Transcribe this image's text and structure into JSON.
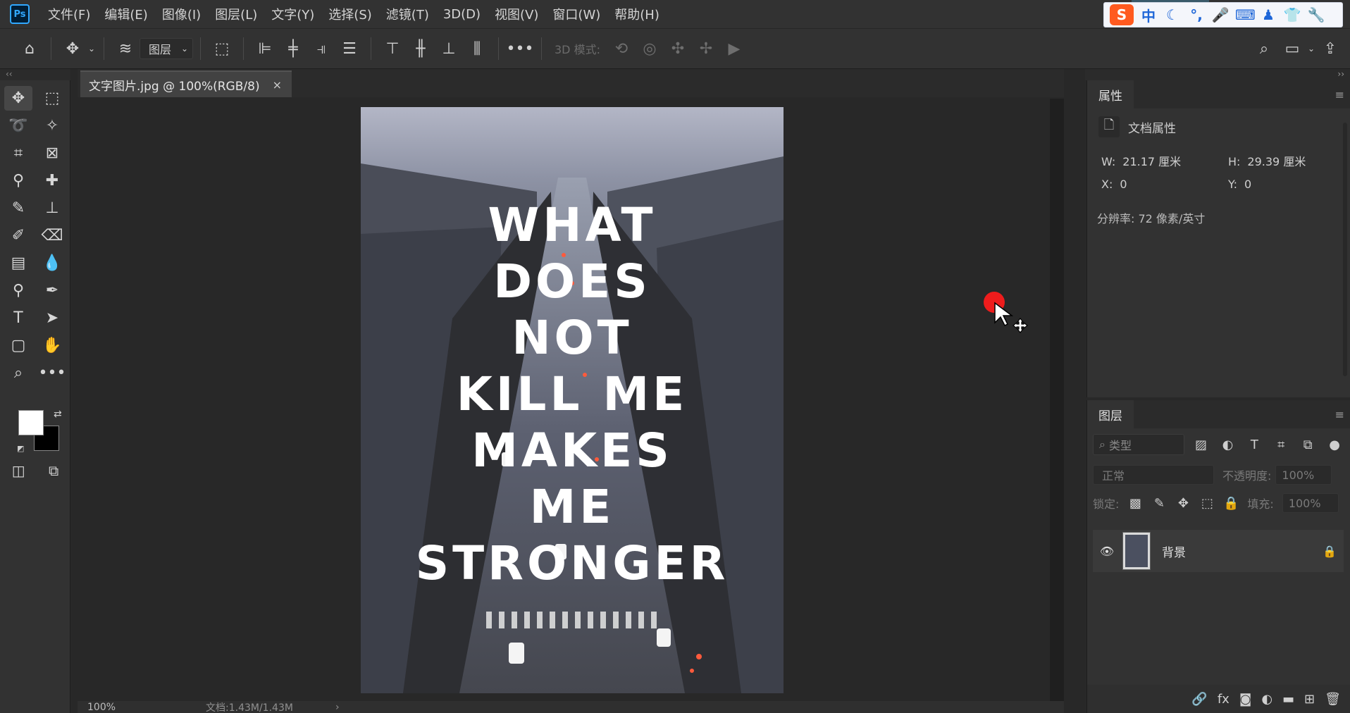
{
  "app": {
    "logo": "Ps"
  },
  "menu": [
    "文件(F)",
    "编辑(E)",
    "图像(I)",
    "图层(L)",
    "文字(Y)",
    "选择(S)",
    "滤镜(T)",
    "3D(D)",
    "视图(V)",
    "窗口(W)",
    "帮助(H)"
  ],
  "ime": {
    "logo": "S",
    "items": [
      "中",
      "☾",
      "°,",
      "mic",
      "keyboard",
      "person",
      "shirt",
      "wrench"
    ]
  },
  "options": {
    "layer_select": "图层",
    "mode_label": "3D 模式:",
    "more": "•••"
  },
  "document": {
    "tab_title": "文字图片.jpg @ 100%(RGB/8)",
    "close": "×",
    "poster_lines": [
      "WHAT",
      "DOES",
      "NOT",
      "KILL ME",
      "MAKES",
      "ME",
      "STRONGER"
    ],
    "poster_colors": {
      "sky": "#a7aabb",
      "street": "#3c3f48",
      "text": "#ffffff"
    }
  },
  "status": {
    "zoom": "100%",
    "doc": "文档:1.43M/1.43M",
    "arrow": "›"
  },
  "properties": {
    "tab": "属性",
    "doc_props": "文档属性",
    "w_label": "W:",
    "w_value": "21.17 厘米",
    "h_label": "H:",
    "h_value": "29.39 厘米",
    "x_label": "X:",
    "x_value": "0",
    "y_label": "Y:",
    "y_value": "0",
    "resolution": "分辨率: 72 像素/英寸"
  },
  "layers": {
    "tab": "图层",
    "filter_placeholder": "类型",
    "blend_mode": "正常",
    "opacity_label": "不透明度:",
    "opacity_value": "100%",
    "lock_label": "锁定:",
    "fill_label": "填充:",
    "fill_value": "100%",
    "layer_name": "背景"
  },
  "colors": {
    "accent": "#31a8ff",
    "cursor": "#ee1c1c",
    "foreground": "#ffffff",
    "background": "#000000"
  }
}
